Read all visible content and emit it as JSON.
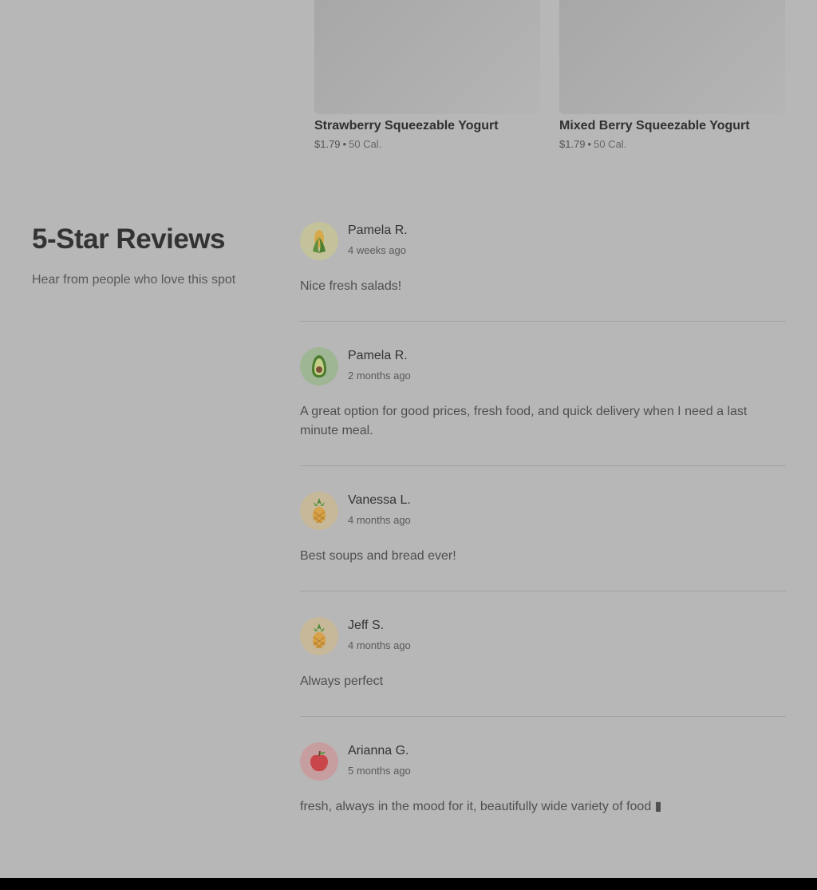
{
  "products": [
    {
      "name": "Strawberry Squeezable Yogurt",
      "price": "$1.79",
      "separator": "•",
      "calories": "50 Cal."
    },
    {
      "name": "Mixed Berry Squeezable Yogurt",
      "price": "$1.79",
      "separator": "•",
      "calories": "50 Cal."
    }
  ],
  "reviews_section": {
    "title": "5-Star Reviews",
    "subtitle": "Hear from people who love this spot"
  },
  "reviews": [
    {
      "name": "Pamela R.",
      "date": "4 weeks ago",
      "text": "Nice fresh salads!",
      "avatar": "corn-icon"
    },
    {
      "name": "Pamela R.",
      "date": "2 months ago",
      "text": "A great option for good prices, fresh food, and quick delivery when I need a last minute meal.",
      "avatar": "avocado-icon"
    },
    {
      "name": "Vanessa L.",
      "date": "4 months ago",
      "text": "Best soups and bread ever!",
      "avatar": "pineapple-icon"
    },
    {
      "name": "Jeff S.",
      "date": "4 months ago",
      "text": "Always perfect",
      "avatar": "pineapple-icon"
    },
    {
      "name": "Arianna G.",
      "date": "5 months ago",
      "text": "fresh, always in the mood for it, beautifully wide variety of food ▮",
      "avatar": "apple-icon"
    }
  ]
}
